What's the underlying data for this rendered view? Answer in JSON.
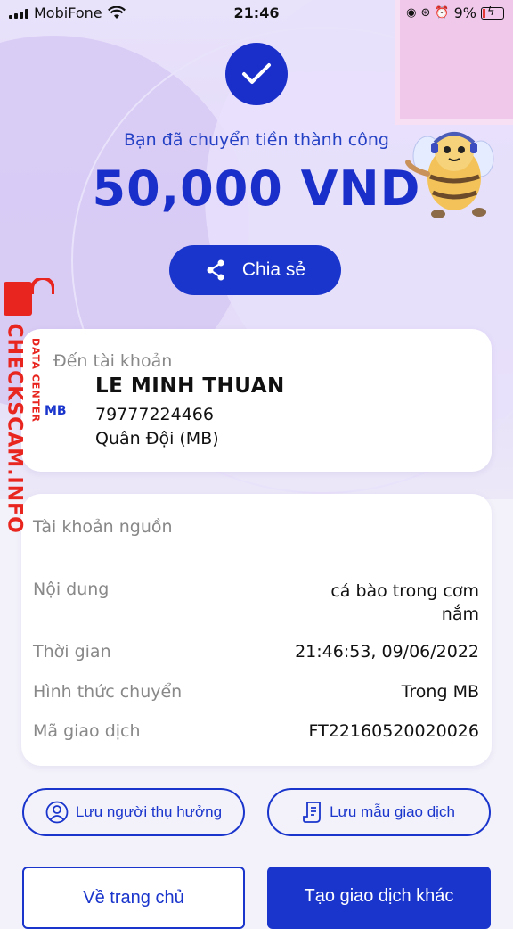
{
  "status_bar": {
    "carrier": "MobiFone",
    "time": "21:46",
    "battery": "9%"
  },
  "result": {
    "message": "Bạn đã chuyển tiền thành công",
    "amount": "50,000 VND"
  },
  "share": {
    "label": "Chia sẻ",
    "icon": "share-icon"
  },
  "recipient": {
    "label": "Đến tài khoản",
    "bank_logo": "MB",
    "name": "LE MINH THUAN",
    "account_number": "79777224466",
    "bank": "Quân Đội (MB)"
  },
  "details": {
    "source_account_label": "Tài khoản nguồn",
    "content_label": "Nội dung",
    "content_value": "cá bào trong cơm nắm",
    "time_label": "Thời gian",
    "time_value": "21:46:53, 09/06/2022",
    "method_label": "Hình thức chuyển",
    "method_value": "Trong MB",
    "code_label": "Mã giao dịch",
    "code_value": "FT22160520020026"
  },
  "actions": {
    "save_payee": "Lưu người thụ hưởng",
    "save_template": "Lưu mẫu giao dịch",
    "home": "Về trang chủ",
    "new_transaction": "Tạo giao dịch khác"
  },
  "watermark": {
    "main": "CHECKSCAM.INFO",
    "sub": "DATA CENTER"
  },
  "colors": {
    "primary": "#1a35cc",
    "watermark": "#e8261f"
  }
}
